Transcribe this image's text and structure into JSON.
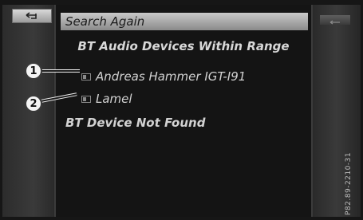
{
  "toolbar": {
    "back_icon": "return-arrow-icon"
  },
  "list": {
    "search_again": "Search Again",
    "header": "BT Audio Devices Within Range",
    "devices": [
      {
        "name": "Andreas Hammer IGT-I91",
        "icon": "phone-icon"
      },
      {
        "name": "Lamel",
        "icon": "phone-icon"
      }
    ],
    "not_found": "BT Device Not Found"
  },
  "callouts": [
    "1",
    "2"
  ],
  "side_code": "P82.89-2210-31"
}
